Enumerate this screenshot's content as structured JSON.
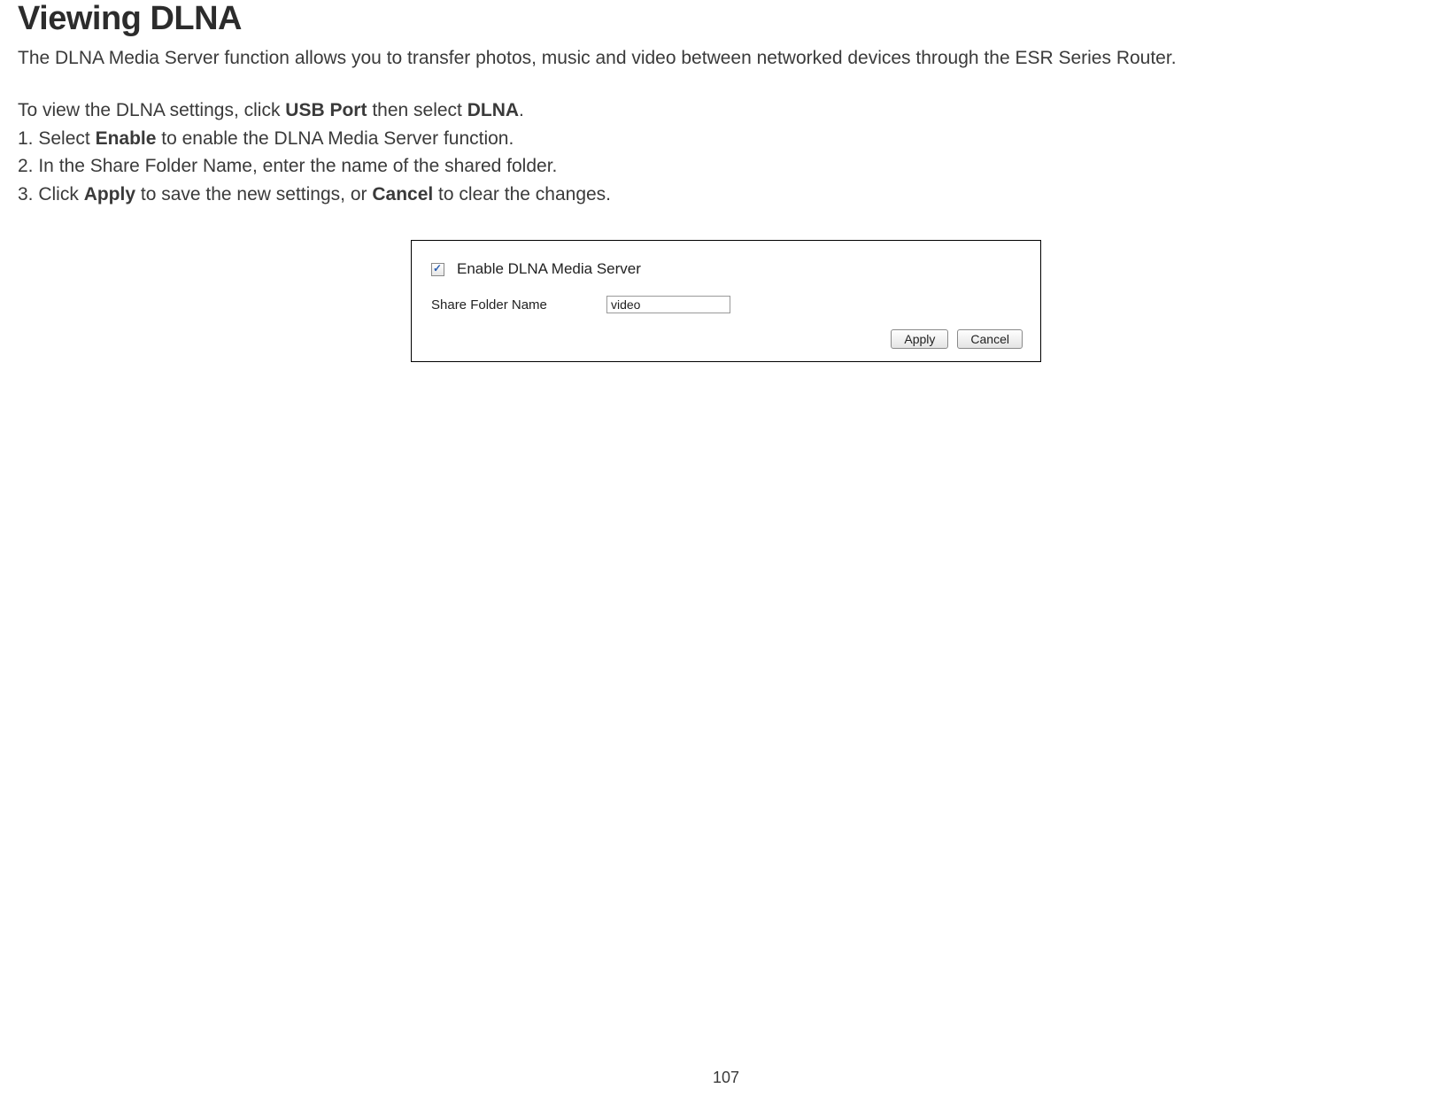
{
  "title": "Viewing DLNA",
  "intro": "The DLNA Media Server function allows you to transfer photos, music and video between networked devices through the ESR Series Router.",
  "nav_instruction": {
    "prefix": "To view the DLNA settings, click ",
    "bold1": "USB Port",
    "middle": " then select ",
    "bold2": "DLNA",
    "suffix": "."
  },
  "steps": {
    "step1": {
      "prefix": "1. Select ",
      "bold": "Enable",
      "suffix": " to enable the DLNA Media Server function."
    },
    "step2": {
      "text": "2. In the Share Folder Name, enter the name of the shared folder."
    },
    "step3": {
      "prefix": "3. Click ",
      "bold1": "Apply",
      "middle": " to save the new settings, or ",
      "bold2": "Cancel",
      "suffix": " to clear the changes."
    }
  },
  "panel": {
    "checkbox_label": "Enable DLNA Media Server",
    "folder_label": "Share Folder Name",
    "folder_value": "video",
    "apply_label": "Apply",
    "cancel_label": "Cancel"
  },
  "page_number": "107"
}
